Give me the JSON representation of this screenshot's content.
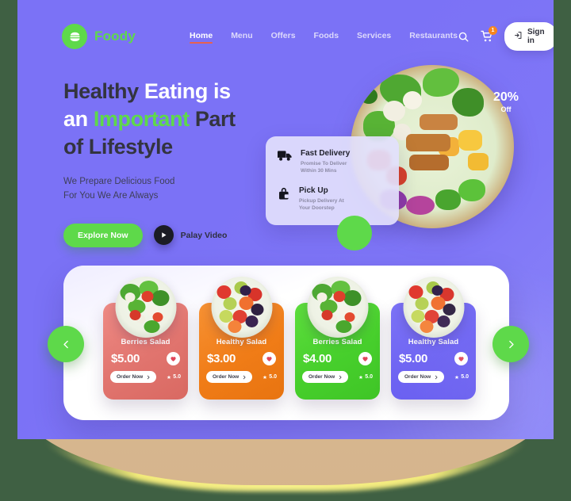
{
  "brand": {
    "name": "Foody",
    "logo_icon": "burger-icon",
    "color": "#5ed94a"
  },
  "nav": {
    "links": [
      {
        "label": "Home",
        "active": true
      },
      {
        "label": "Menu",
        "active": false
      },
      {
        "label": "Offers",
        "active": false
      },
      {
        "label": "Foods",
        "active": false
      },
      {
        "label": "Services",
        "active": false
      },
      {
        "label": "Restaurants",
        "active": false
      }
    ],
    "search_icon": "search-icon",
    "cart_icon": "shopping-cart-icon",
    "cart_badge": "1",
    "signin_label": "Sign in",
    "signin_icon": "login-icon"
  },
  "hero": {
    "headline": {
      "line1_a": "Healthy ",
      "line1_b": "Eating is",
      "line2_a": "an ",
      "line2_b": "Important ",
      "line2_c": "Part",
      "line3": "of Lifestyle"
    },
    "subtext_line1": "We Prepare Delicious Food",
    "subtext_line2": "For You We Are Always",
    "explore_label": "Explore Now",
    "play_label": "Palay Video",
    "play_icon": "play-icon",
    "discount_value": "20%",
    "discount_label": "Off"
  },
  "delivery": {
    "items": [
      {
        "icon": "delivery-truck-icon",
        "title": "Fast Delivery",
        "sub_line1": "Promise To Deliver",
        "sub_line2": "Within 30 Mins"
      },
      {
        "icon": "pickup-bag-icon",
        "title": "Pick Up",
        "sub_line1": "Pickup Delivery At",
        "sub_line2": "Your Doorstep"
      }
    ]
  },
  "carousel": {
    "prev_icon": "chevron-left-icon",
    "next_icon": "chevron-right-icon",
    "order_label": "Order Now",
    "cards": [
      {
        "name": "Berries Salad",
        "price": "$5.00",
        "rating": "5.0",
        "order_label": "Order Now",
        "theme": "red",
        "color": "#e1746e"
      },
      {
        "name": "Healthy Salad",
        "price": "$3.00",
        "rating": "5.0",
        "order_label": "Order Now",
        "theme": "orange",
        "color": "#f07c17"
      },
      {
        "name": "Berries Salad",
        "price": "$4.00",
        "rating": "5.0",
        "order_label": "Order Now",
        "theme": "green",
        "color": "#47cf2c"
      },
      {
        "name": "Healthy Salad",
        "price": "$5.00",
        "rating": "5.0",
        "order_label": "Order Now",
        "theme": "purple",
        "color": "#6a60f2"
      }
    ]
  }
}
